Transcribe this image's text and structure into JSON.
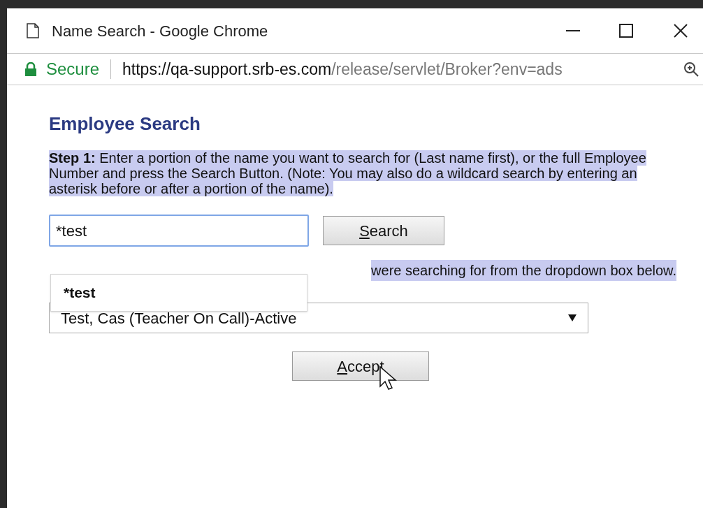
{
  "window": {
    "title": "Name Search - Google Chrome"
  },
  "address_bar": {
    "security": "Secure",
    "url_host": "https://qa-support.srb-es.com",
    "url_path": "/release/servlet/Broker?env=ads"
  },
  "heading": "Employee Search",
  "step1": "**Step 1:** Enter a portion of the name you want to search for (Last name first), or the full Employee Number and press the Search Button. (Note: You may also do a wildcard search by entering an asterisk before or after a portion of the name).",
  "search_field": {
    "value": "*test"
  },
  "search_button": "Search",
  "autocomplete": [
    "*test"
  ],
  "step2_visible": "were searching for from the dropdown box below.",
  "employee_select": {
    "value": "Test, Cas (Teacher On Call)-Active"
  },
  "accept_button": "Accept"
}
